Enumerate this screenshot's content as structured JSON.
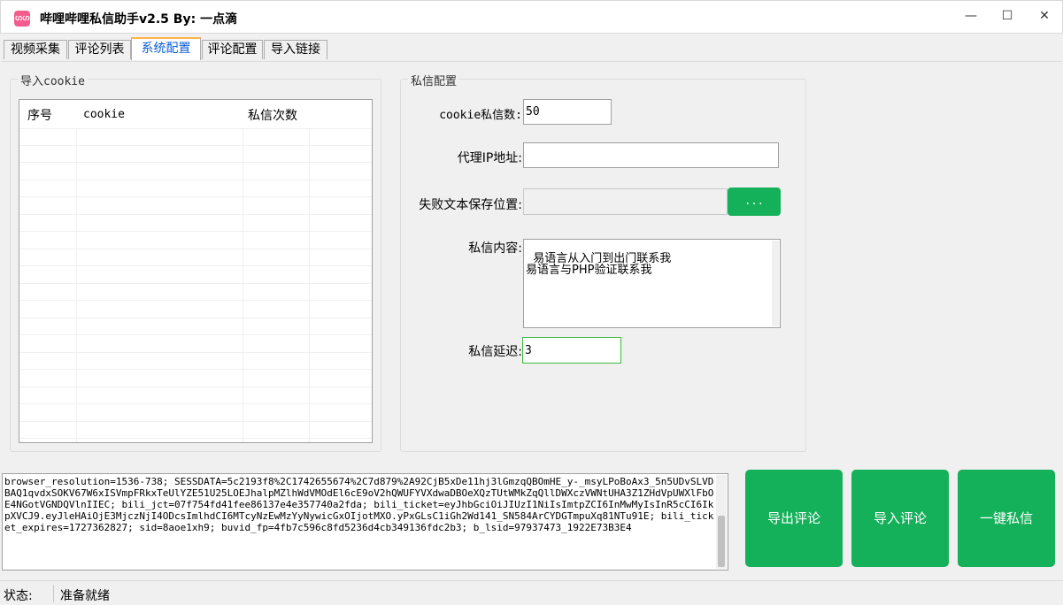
{
  "window": {
    "app_icon_text": "ഗഗ",
    "title": "哔哩哔哩私信助手v2.5 By: 一点滴",
    "minimize": "—",
    "maximize": "☐",
    "close": "✕"
  },
  "tabs": [
    {
      "label": "视频采集",
      "active": false
    },
    {
      "label": "评论列表",
      "active": false
    },
    {
      "label": "系统配置",
      "active": true
    },
    {
      "label": "评论配置",
      "active": false
    },
    {
      "label": "导入链接",
      "active": false
    }
  ],
  "import_cookie": {
    "group_title": "导入cookie",
    "columns": [
      "序号",
      "cookie",
      "私信次数"
    ],
    "rows": []
  },
  "dm_config": {
    "group_title": "私信配置",
    "cookie_count_label": "cookie私信数:",
    "cookie_count_value": "50",
    "proxy_label": "代理IP地址:",
    "proxy_value": "",
    "fail_path_label": "失败文本保存位置:",
    "fail_path_value": "",
    "browse_label": "...",
    "content_label": "私信内容:",
    "content_value": "易语言从入门到出门联系我\n易语言与PHP验证联系我",
    "delay_label": "私信延迟:",
    "delay_value": "3"
  },
  "cookie_text": "browser_resolution=1536-738; SESSDATA=5c2193f8%2C1742655674%2C7d879%2A92CjB5xDe11hj3lGmzqQBOmHE_y-_msyLPoBoAx3_5n5UDvSLVDBAQ1qvdxSOKV67W6xISVmpFRkxTeUlYZE51U25LOEJhalpMZlhWdVMOdEl6cE9oV2hQWUFYVXdwaDBOeXQzTUtWMkZqQllDWXczVWNtUHA3Z1ZHdVpUWXlFbOE4NGotVGNDQVlnIIEC; bili_jct=07f754fd41fee86137e4e357740a2fda; bili_ticket=eyJhbGciOiJIUzI1NiIsImtpZCI6InMwMyIsInR5cCI6IkpXVCJ9.eyJleHAiOjE3MjczNjI4ODcsImlhdCI6MTcyNzEwMzYyNywicGxOIjotMXO.yPxGLsC1iGh2Wd141_SN584ArCYDGTmpuXq81NTu91E; bili_ticket_expires=1727362827; sid=8aoe1xh9; buvid_fp=4fb7c596c8fd5236d4cb349136fdc2b3; b_lsid=97937473_1922E73B3E4",
  "actions": {
    "export_comments": "导出评论",
    "import_comments": "导入评论",
    "one_click_dm": "一键私信"
  },
  "status": {
    "label": "状态:",
    "text": "准备就绪"
  }
}
